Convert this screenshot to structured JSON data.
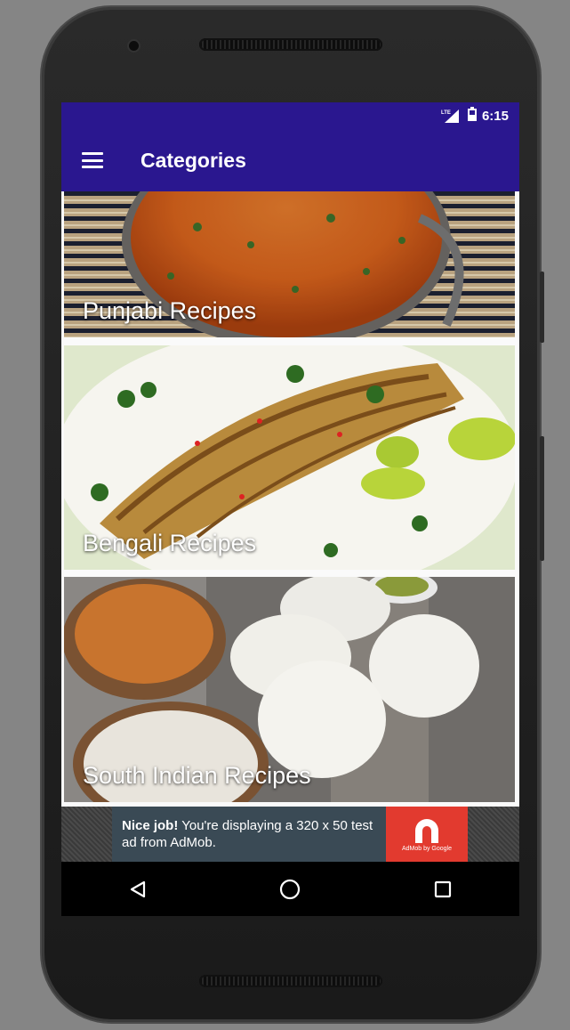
{
  "status_bar": {
    "network": "LTE",
    "time": "6:15"
  },
  "app_bar": {
    "title": "Categories",
    "color": "#2a178f"
  },
  "categories": [
    {
      "label": "Punjabi Recipes"
    },
    {
      "label": "Bengali Recipes"
    },
    {
      "label": "South Indian Recipes"
    }
  ],
  "ad": {
    "bold_text": "Nice job!",
    "text": " You're displaying a 320 x 50 test ad from AdMob.",
    "logo_caption": "AdMob by Google",
    "logo_color": "#e23a2f"
  },
  "nav": {
    "back": "back-icon",
    "home": "home-icon",
    "recents": "recents-icon"
  }
}
